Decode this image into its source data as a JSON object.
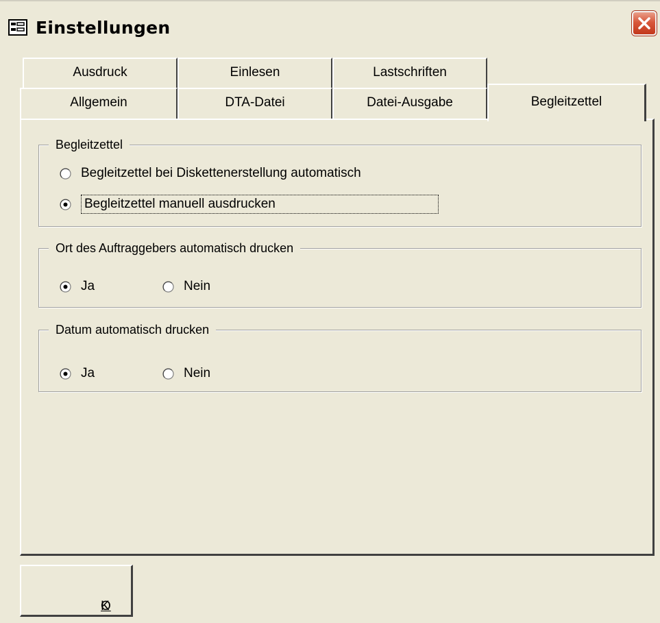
{
  "window": {
    "title": "Einstellungen"
  },
  "tabs_back": [
    "Ausdruck",
    "Einlesen",
    "Lastschriften"
  ],
  "tabs_front": [
    "Allgemein",
    "DTA-Datei",
    "Datei-Ausgabe",
    "Begleitzettel"
  ],
  "active_tab": "Begleitzettel",
  "groups": {
    "begleitzettel": {
      "legend": "Begleitzettel",
      "opt_auto": "Begleitzettel bei Diskettenerstellung automatisch",
      "opt_manual": "Begleitzettel manuell ausdrucken",
      "selected": "Begleitzettel manuell ausdrucken"
    },
    "ort": {
      "legend": "Ort des Auftraggebers automatisch drucken",
      "yes": "Ja",
      "no": "Nein",
      "selected": "Ja"
    },
    "datum": {
      "legend": "Datum automatisch drucken",
      "yes": "Ja",
      "no": "Nein",
      "selected": "Ja"
    }
  },
  "ok_button": {
    "mnemonic": "O",
    "rest": "K"
  },
  "icons": {
    "window_icon": "window-form-icon",
    "close": "close-icon",
    "radio_on": "radio-selected-icon",
    "radio_off": "radio-unselected-icon"
  },
  "colors": {
    "face": "#ece9d8",
    "close_button": "#d8583b"
  }
}
